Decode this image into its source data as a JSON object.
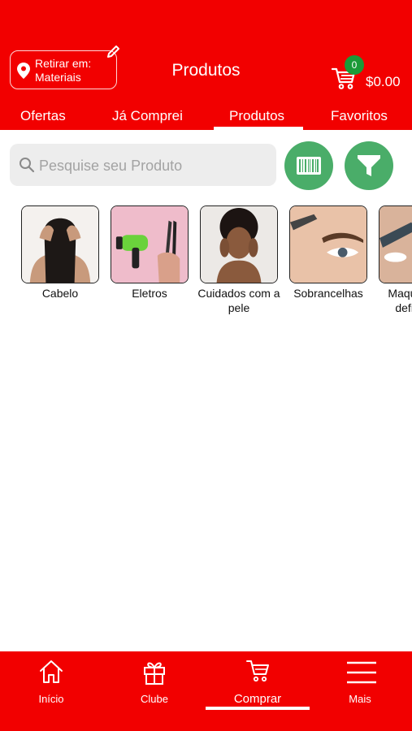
{
  "header": {
    "pickup": {
      "line1": "Retirar em:",
      "line2": "Materiais"
    },
    "title": "Produtos",
    "cart": {
      "count": "0",
      "total": "$0.00"
    },
    "colors": {
      "brand": "#f20000",
      "badge": "#1a9a37"
    }
  },
  "tabs": [
    {
      "label": "Ofertas"
    },
    {
      "label": "Já Comprei"
    },
    {
      "label": "Produtos",
      "active": true
    },
    {
      "label": "Favoritos"
    }
  ],
  "search": {
    "placeholder": "Pesquise seu Produto",
    "value": "",
    "icons": [
      "search-icon",
      "barcode-icon",
      "filter-icon"
    ],
    "button_color": "#4aad69"
  },
  "categories": [
    {
      "label": "Cabelo"
    },
    {
      "label": "Eletros"
    },
    {
      "label": "Cuidados com a pele"
    },
    {
      "label": "Sobrancelhas"
    },
    {
      "label": "Maquiagem definitiva"
    }
  ],
  "bottom_nav": [
    {
      "label": "Início",
      "icon": "home-icon"
    },
    {
      "label": "Clube",
      "icon": "gift-icon"
    },
    {
      "label": "Comprar",
      "icon": "cart-icon",
      "active": true
    },
    {
      "label": "Mais",
      "icon": "menu-icon"
    }
  ]
}
